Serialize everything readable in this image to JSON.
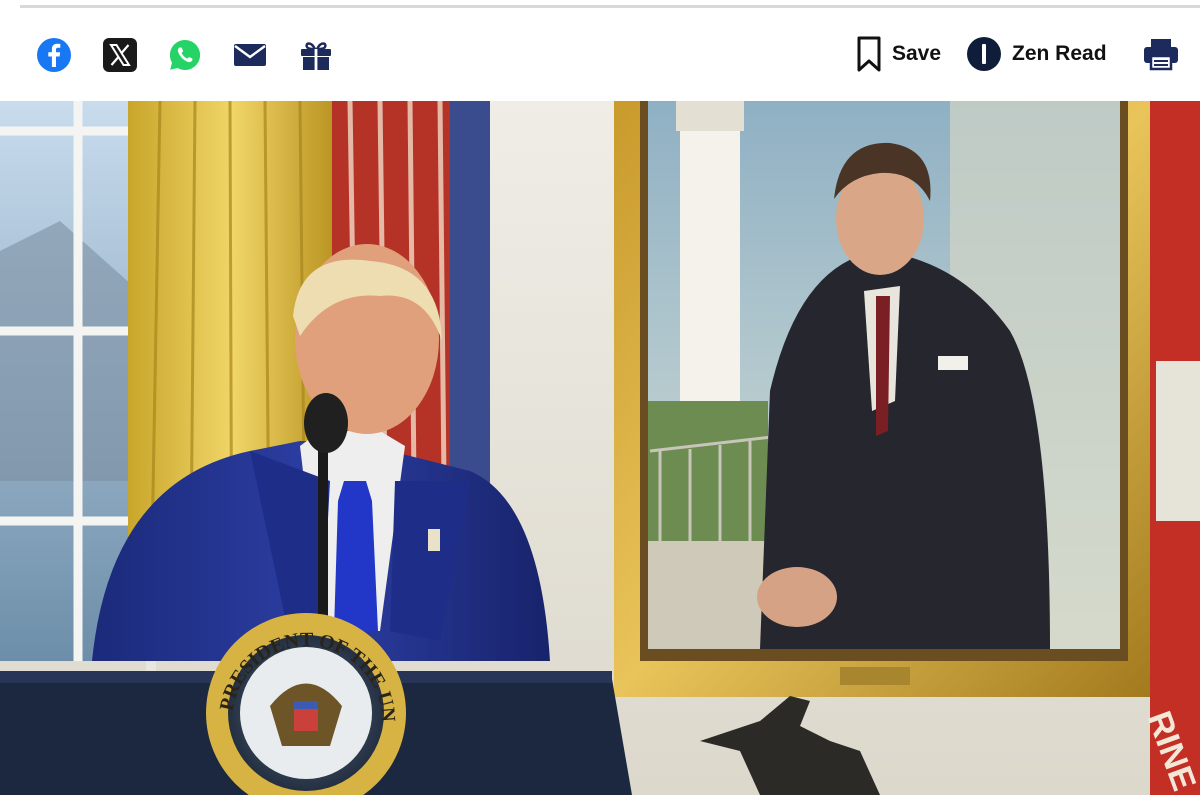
{
  "share": {
    "items": [
      {
        "icon": "facebook-icon",
        "color": "#1877f2"
      },
      {
        "icon": "x-icon",
        "color": "#111111"
      },
      {
        "icon": "whatsapp-icon",
        "color": "#25d366"
      },
      {
        "icon": "email-icon",
        "color": "#1c2a5c"
      },
      {
        "icon": "gift-icon",
        "color": "#1c2a5c"
      }
    ]
  },
  "tools": {
    "save_label": "Save",
    "zen_label": "Zen Read",
    "save_icon": "bookmark-icon",
    "zen_icon": "zen-read-icon",
    "print_icon": "print-icon"
  },
  "photo": {
    "seal_text": "PRESIDENT OF THE UNITED STATES",
    "flag_text": "RINE"
  }
}
